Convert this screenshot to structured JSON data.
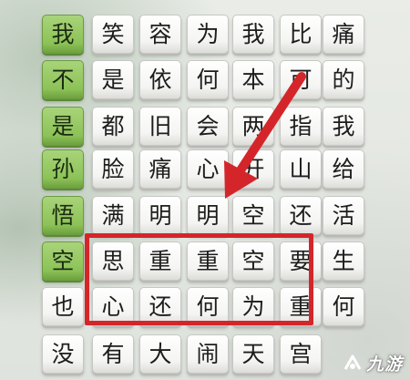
{
  "grid": {
    "rows": [
      [
        "我",
        "笑",
        "容",
        "为",
        "我",
        "比",
        "痛"
      ],
      [
        "不",
        "是",
        "依",
        "何",
        "本",
        "可",
        "的"
      ],
      [
        "是",
        "都",
        "旧",
        "会",
        "两",
        "指",
        "我"
      ],
      [
        "孙",
        "脸",
        "痛",
        "心",
        "开",
        "山",
        "给"
      ],
      [
        "悟",
        "满",
        "明",
        "明",
        "空",
        "还",
        "活"
      ],
      [
        "空",
        "思",
        "重",
        "重",
        "空",
        "要",
        "生"
      ],
      [
        "也",
        "心",
        "还",
        "何",
        "为",
        "重",
        "何"
      ],
      [
        "没",
        "有",
        "大",
        "闹",
        "天",
        "宫",
        ""
      ]
    ],
    "selected_column": 0,
    "selected_rows": [
      0,
      1,
      2,
      3,
      4,
      5
    ],
    "highlighted_rows": [
      5,
      6
    ],
    "highlighted_columns": [
      1,
      2,
      3,
      4,
      5
    ]
  },
  "annotation": {
    "box_color": "#d4262a",
    "arrow_color": "#d4262a",
    "arrow_points_to": "row 6 highlight box"
  },
  "watermark": {
    "text": "九游",
    "icon": "jiuyou-logo-icon"
  },
  "colors": {
    "tile_face": "#ffffff",
    "selected_tile": "#8cc257",
    "background": "#e6e9e4"
  }
}
